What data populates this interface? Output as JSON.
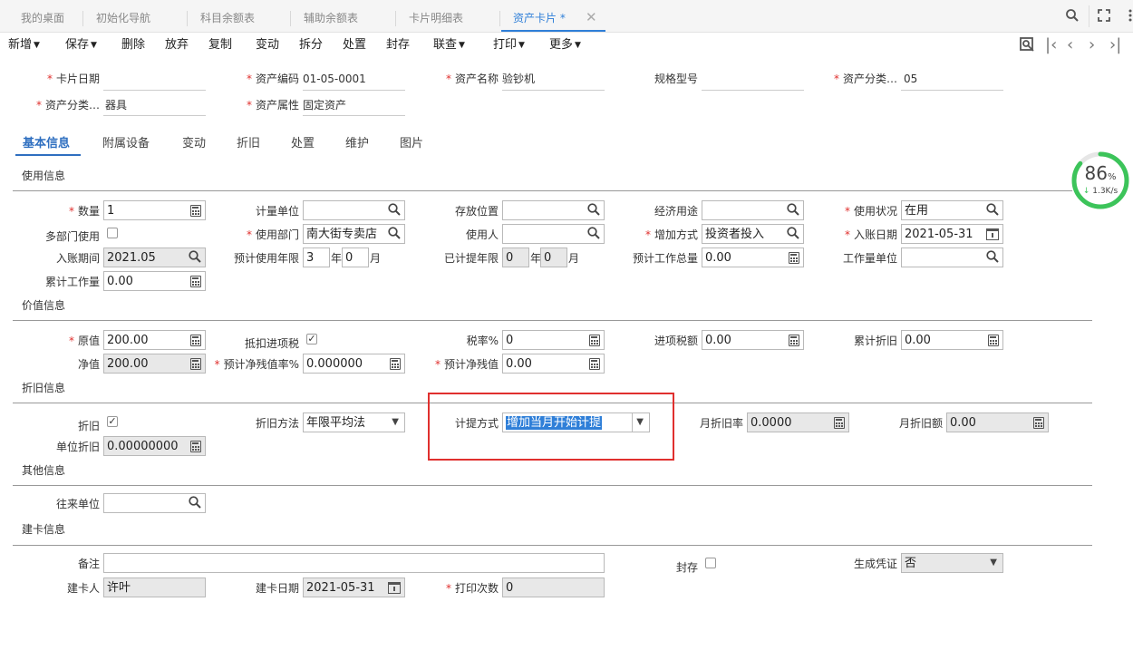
{
  "tabs": [
    {
      "label": "我的桌面"
    },
    {
      "label": "初始化导航"
    },
    {
      "label": "科目余额表"
    },
    {
      "label": "辅助余额表"
    },
    {
      "label": "卡片明细表"
    },
    {
      "label": "资产卡片 *"
    }
  ],
  "toolbar": {
    "new": "新增",
    "save": "保存",
    "delete": "删除",
    "discard": "放弃",
    "copy": "复制",
    "change": "变动",
    "split": "拆分",
    "dispose": "处置",
    "seal": "封存",
    "query": "联查",
    "print": "打印",
    "more": "更多"
  },
  "header": {
    "card_date_label": "卡片日期",
    "card_date": "",
    "asset_code_label": "资产编码",
    "asset_code": "01-05-0001",
    "asset_name_label": "资产名称",
    "asset_name": "验钞机",
    "spec_label": "规格型号",
    "spec": "",
    "asset_cat_code_label": "资产分类…",
    "asset_cat_code": "05",
    "asset_cat_name_label": "资产分类…",
    "asset_cat_name": "器具",
    "asset_attr_label": "资产属性",
    "asset_attr": "固定资产"
  },
  "form_tabs": [
    "基本信息",
    "附属设备",
    "变动",
    "折旧",
    "处置",
    "维护",
    "图片"
  ],
  "sections": {
    "usage": "使用信息",
    "value": "价值信息",
    "depreciation": "折旧信息",
    "other": "其他信息",
    "card": "建卡信息"
  },
  "usage": {
    "qty_label": "数量",
    "qty": "1",
    "unit_label": "计量单位",
    "unit": "",
    "location_label": "存放位置",
    "location": "",
    "purpose_label": "经济用途",
    "purpose": "",
    "status_label": "使用状况",
    "status": "在用",
    "multi_dept_label": "多部门使用",
    "dept_label": "使用部门",
    "dept": "南大街专卖店",
    "user_label": "使用人",
    "user": "",
    "add_method_label": "增加方式",
    "add_method": "投资者投入",
    "entry_date_label": "入账日期",
    "entry_date": "2021-05-31",
    "entry_period_label": "入账期间",
    "entry_period": "2021.05",
    "est_years_label": "预计使用年限",
    "est_years": "3",
    "years_unit": "年",
    "est_months": "0",
    "months_unit": "月",
    "used_years_label": "已计提年限",
    "used_years": "0",
    "used_months": "0",
    "est_workload_label": "预计工作总量",
    "est_workload": "0.00",
    "workload_unit_label": "工作量单位",
    "workload_unit": "",
    "acc_workload_label": "累计工作量",
    "acc_workload": "0.00"
  },
  "value": {
    "orig_label": "原值",
    "orig": "200.00",
    "deduct_label": "抵扣进项税",
    "tax_rate_label": "税率%",
    "tax_rate": "0",
    "input_tax_label": "进项税额",
    "input_tax": "0.00",
    "acc_dep_label": "累计折旧",
    "acc_dep": "0.00",
    "net_label": "净值",
    "net": "200.00",
    "residual_rate_label": "预计净残值率%",
    "residual_rate": "0.000000",
    "residual_label": "预计净残值",
    "residual": "0.00"
  },
  "depreciation": {
    "dep_label": "折旧",
    "method_label": "折旧方法",
    "method": "年限平均法",
    "accrual_label": "计提方式",
    "accrual": "增加当月开始计提",
    "month_rate_label": "月折旧率",
    "month_rate": "0.0000",
    "month_amount_label": "月折旧额",
    "month_amount": "0.00",
    "unit_dep_label": "单位折旧",
    "unit_dep": "0.00000000"
  },
  "other": {
    "partner_label": "往来单位",
    "partner": ""
  },
  "card": {
    "memo_label": "备注",
    "memo": "",
    "seal_label": "封存",
    "voucher_label": "生成凭证",
    "voucher": "否",
    "creator_label": "建卡人",
    "creator": "许叶",
    "create_date_label": "建卡日期",
    "create_date": "2021-05-31",
    "print_count_label": "打印次数",
    "print_count": "0"
  },
  "gauge": {
    "percent": "86",
    "unit": "%",
    "speed": "1.3K/s",
    "level": 0.86
  }
}
